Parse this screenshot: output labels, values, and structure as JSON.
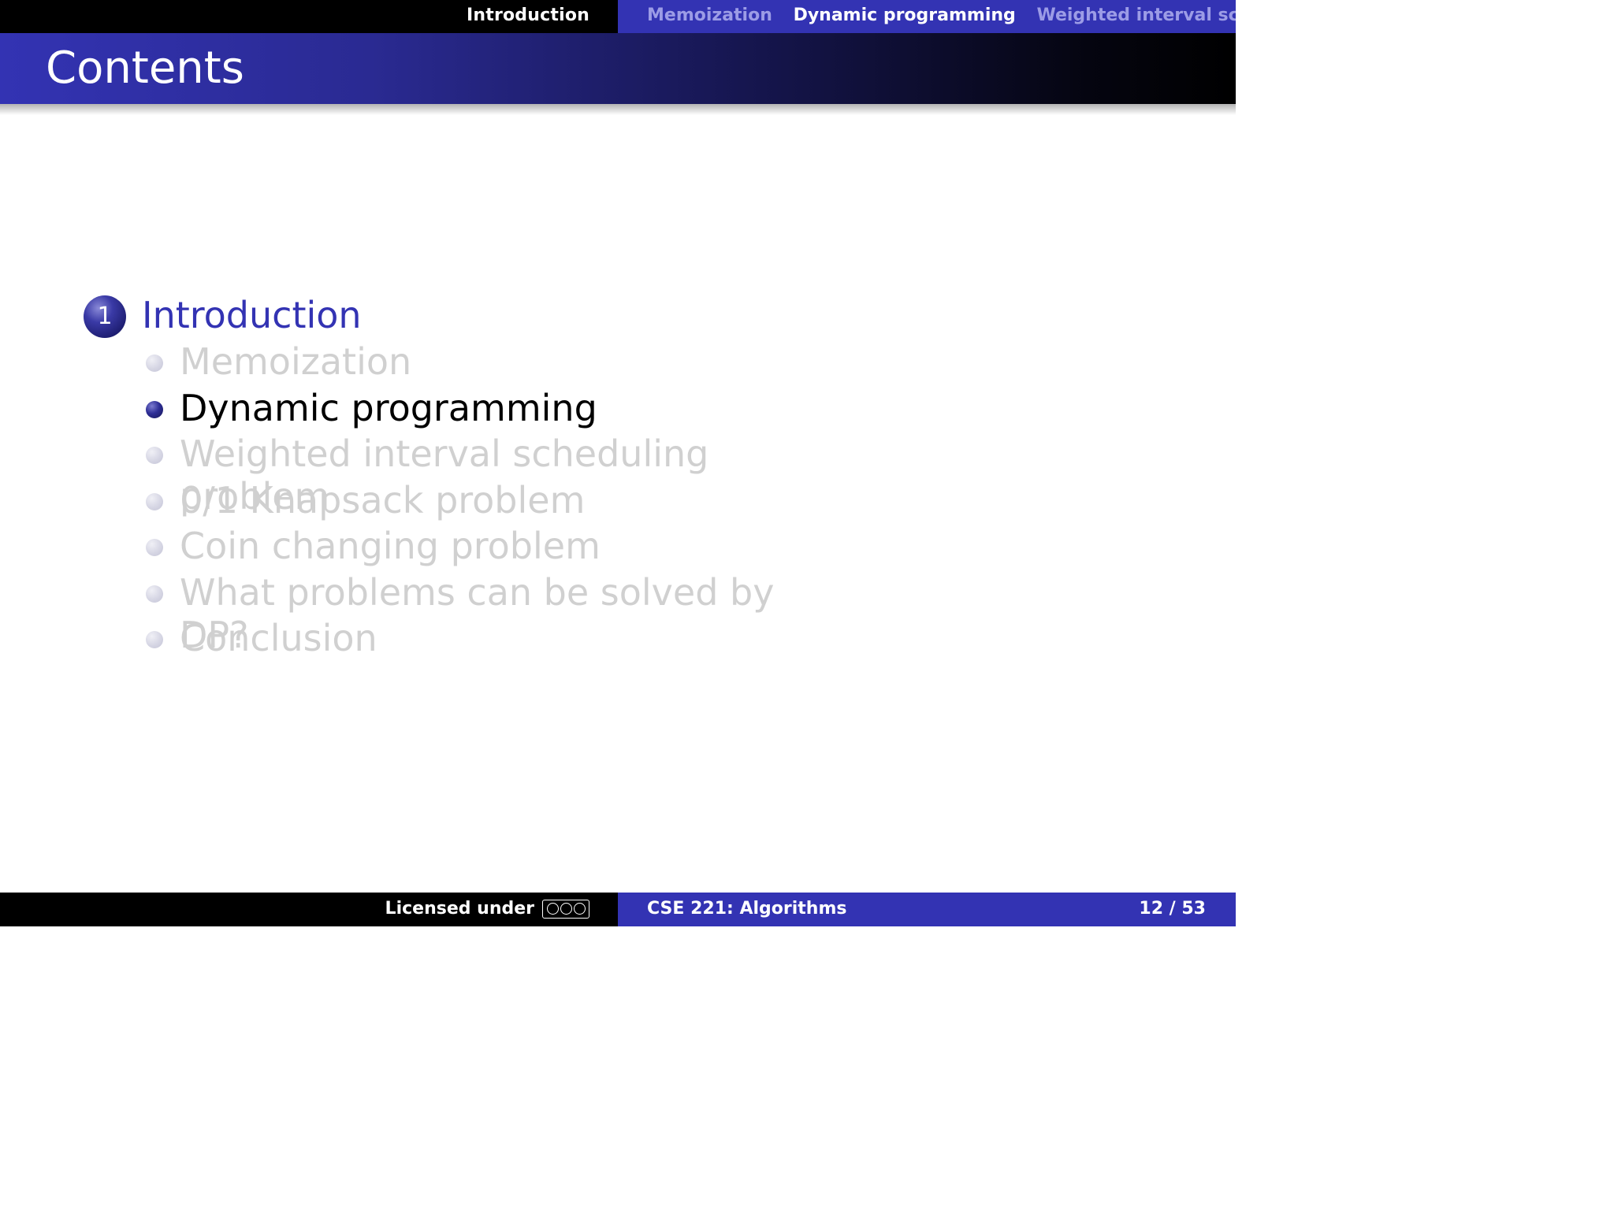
{
  "nav": {
    "section": "Introduction",
    "subsections": [
      {
        "label": "Memoization",
        "active": false
      },
      {
        "label": "Dynamic programming",
        "active": true
      },
      {
        "label": "Weighted interval sched",
        "active": false
      }
    ]
  },
  "title": "Contents",
  "outline": {
    "section_number": "1",
    "section_title": "Introduction",
    "items": [
      {
        "label": "Memoization",
        "active": false
      },
      {
        "label": "Dynamic programming",
        "active": true
      },
      {
        "label": "Weighted interval scheduling problem",
        "active": false
      },
      {
        "label": "0/1 Knapsack problem",
        "active": false
      },
      {
        "label": "Coin changing problem",
        "active": false
      },
      {
        "label": "What problems can be solved by DP?",
        "active": false
      },
      {
        "label": "Conclusion",
        "active": false
      }
    ]
  },
  "footer": {
    "license_text": "Licensed under",
    "license_badge": "cc-by-nc-sa-icon",
    "course": "CSE 221: Algorithms",
    "page": "12 / 53"
  },
  "colors": {
    "accent": "#3333b3",
    "inactive_text": "#d0d0d0",
    "inactive_nav": "#9c9ce6"
  }
}
